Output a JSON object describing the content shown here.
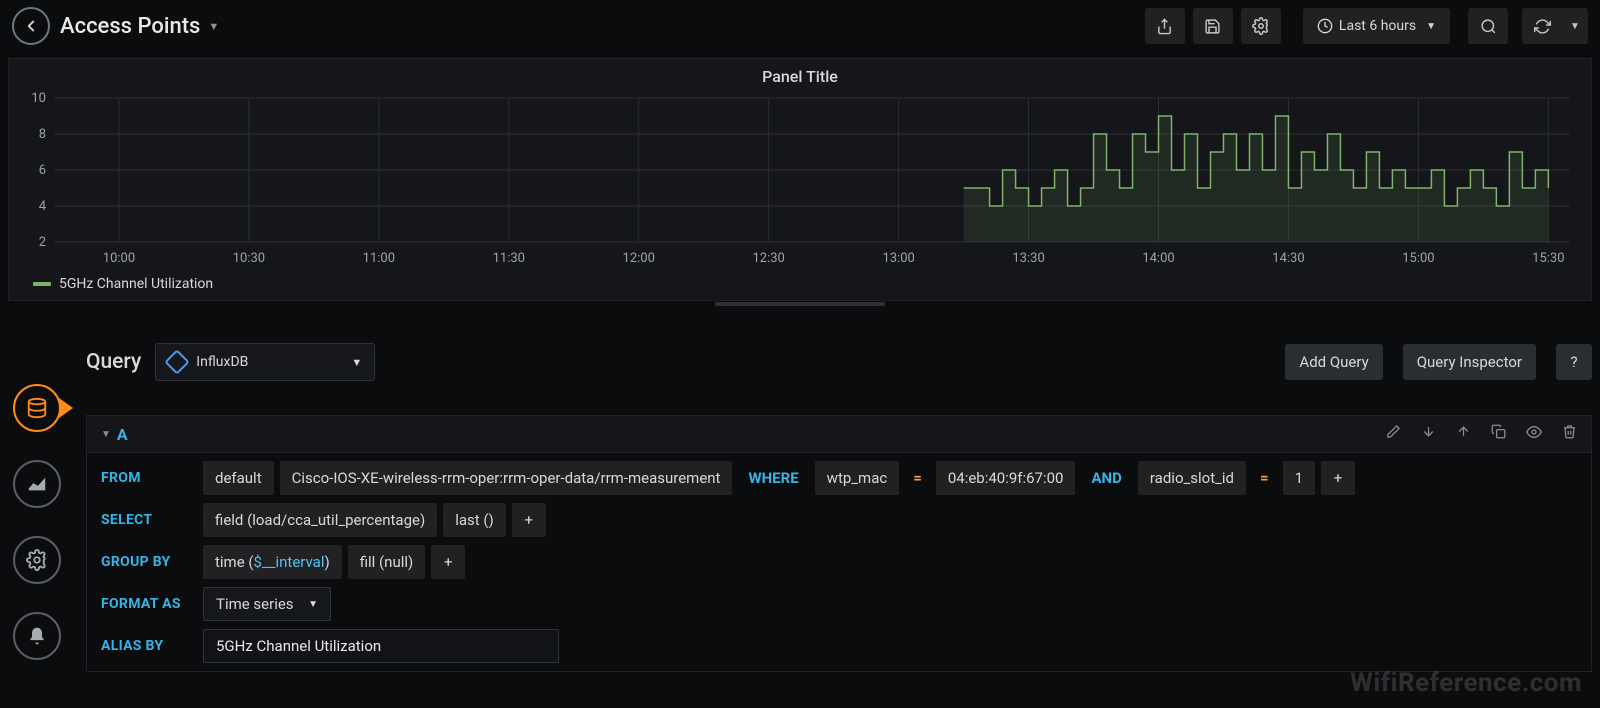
{
  "header": {
    "title": "Access Points",
    "time_range": "Last 6 hours"
  },
  "panel": {
    "title": "Panel Title",
    "legend_label": "5GHz Channel Utilization"
  },
  "chart_data": {
    "type": "line",
    "title": "Panel Title",
    "xlabel": "",
    "ylabel": "",
    "ylim": [
      2,
      10
    ],
    "y_ticks": [
      2,
      4,
      6,
      8,
      10
    ],
    "x_ticks": [
      "10:00",
      "10:30",
      "11:00",
      "11:30",
      "12:00",
      "12:30",
      "13:00",
      "13:30",
      "14:00",
      "14:30",
      "15:00",
      "15:30"
    ],
    "series": [
      {
        "name": "5GHz Channel Utilization",
        "color": "#7EB26D",
        "x": [
          "13:15",
          "13:18",
          "13:21",
          "13:24",
          "13:27",
          "13:30",
          "13:33",
          "13:36",
          "13:39",
          "13:42",
          "13:45",
          "13:48",
          "13:51",
          "13:54",
          "13:57",
          "14:00",
          "14:03",
          "14:06",
          "14:09",
          "14:12",
          "14:15",
          "14:18",
          "14:21",
          "14:24",
          "14:27",
          "14:30",
          "14:33",
          "14:36",
          "14:39",
          "14:42",
          "14:45",
          "14:48",
          "14:51",
          "14:54",
          "14:57",
          "15:00",
          "15:03",
          "15:06",
          "15:09",
          "15:12",
          "15:15",
          "15:18",
          "15:21",
          "15:24",
          "15:27",
          "15:30"
        ],
        "values": [
          5,
          5,
          4,
          6,
          5,
          4,
          5,
          6,
          4,
          5,
          8,
          6,
          5,
          8,
          7,
          9,
          6,
          8,
          5,
          7,
          8,
          6,
          8,
          6,
          9,
          5,
          7,
          6,
          8,
          6,
          5,
          7,
          5,
          6,
          5,
          5,
          6,
          4,
          5,
          6,
          5,
          4,
          7,
          5,
          6,
          5
        ]
      }
    ]
  },
  "query_header": {
    "tab_label": "Query",
    "datasource": "InfluxDB",
    "add_query": "Add Query",
    "inspector": "Query Inspector",
    "help": "?"
  },
  "query_row": {
    "letter": "A",
    "labels": {
      "from": "FROM",
      "select": "SELECT",
      "group_by": "GROUP BY",
      "format_as": "FORMAT AS",
      "alias_by": "ALIAS BY",
      "where": "WHERE",
      "and": "AND"
    },
    "from_default": "default",
    "from_measurement": "Cisco-IOS-XE-wireless-rrm-oper:rrm-oper-data/rrm-measurement",
    "where_field1": "wtp_mac",
    "where_op": "=",
    "where_val1": "04:eb:40:9f:67:00",
    "where_field2": "radio_slot_id",
    "where_val2": "1",
    "select_field": "field (load/cca_util_percentage)",
    "select_agg": "last ()",
    "groupby_time_pre": "time (",
    "groupby_time_var": "$__interval",
    "groupby_time_post": ")",
    "groupby_fill": "fill (null)",
    "format_as_value": "Time series",
    "alias_value": "5GHz Channel Utilization",
    "plus": "+"
  },
  "watermark": "WifiReference.com"
}
